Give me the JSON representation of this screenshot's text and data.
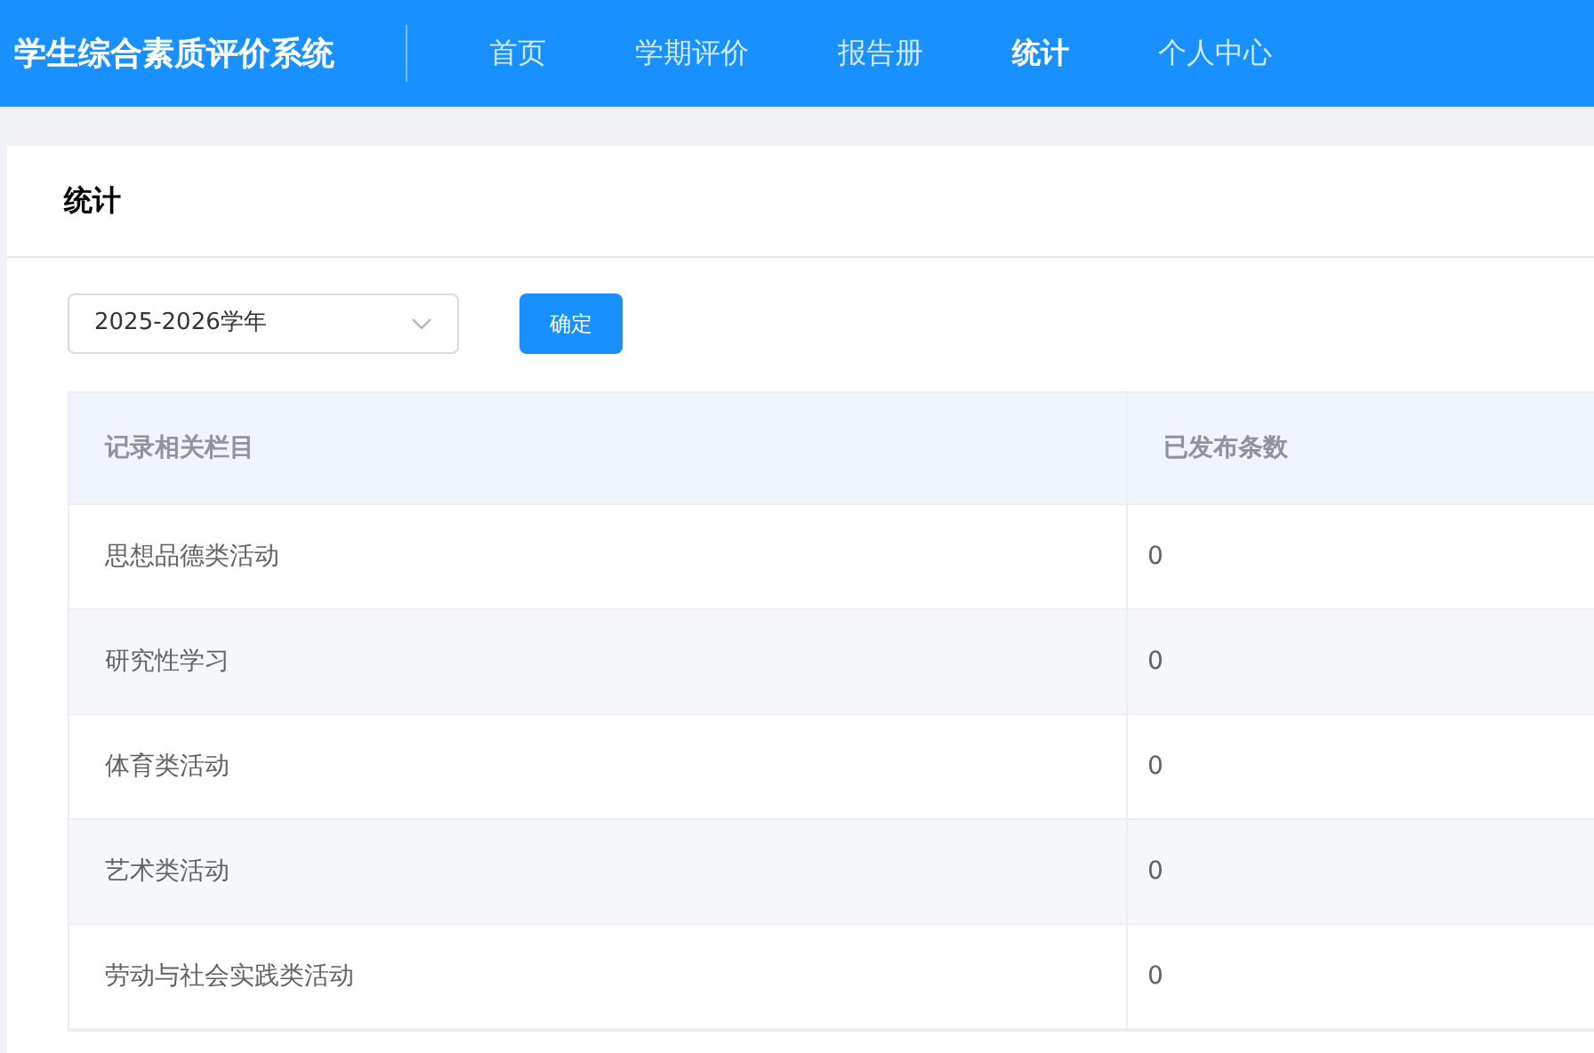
{
  "app_title": "学生综合素质评价系统",
  "nav": [
    {
      "label": "首页",
      "selected": false
    },
    {
      "label": "学期评价",
      "selected": false
    },
    {
      "label": "报告册",
      "selected": false
    },
    {
      "label": "统计",
      "selected": true
    },
    {
      "label": "个人中心",
      "selected": false
    }
  ],
  "card_title": "统计",
  "year_select": {
    "value": "2025-2026学年"
  },
  "confirm_button": "确定",
  "table": {
    "columns": [
      "记录相关栏目",
      "已发布条数"
    ],
    "rows": [
      [
        "思想品德类活动",
        "0"
      ],
      [
        "研究性学习",
        "0"
      ],
      [
        "体育类活动",
        "0"
      ],
      [
        "艺术类活动",
        "0"
      ],
      [
        "劳动与社会实践类活动",
        "0"
      ]
    ]
  }
}
